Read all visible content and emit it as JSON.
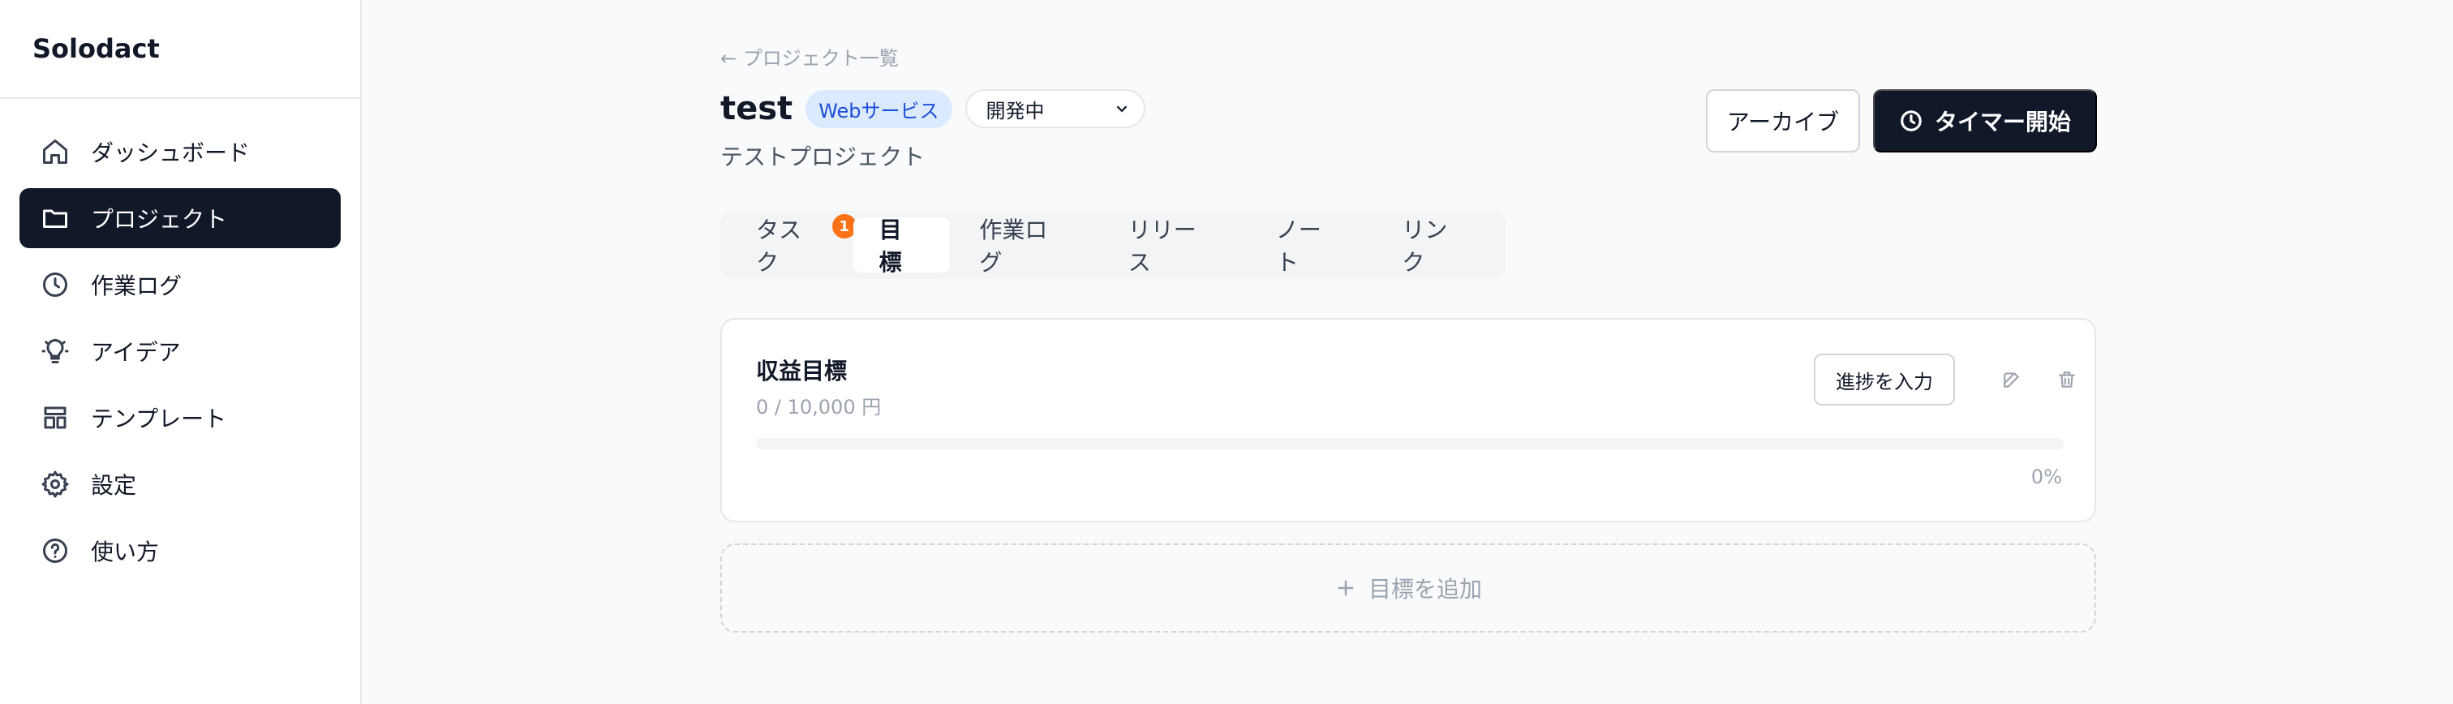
{
  "app": {
    "name": "Solodact"
  },
  "sidebar": {
    "items": [
      {
        "label": "ダッシュボード",
        "icon": "home-icon",
        "active": false
      },
      {
        "label": "プロジェクト",
        "icon": "folder-icon",
        "active": true
      },
      {
        "label": "作業ログ",
        "icon": "clock-icon",
        "active": false
      },
      {
        "label": "アイデア",
        "icon": "lightbulb-icon",
        "active": false
      },
      {
        "label": "テンプレート",
        "icon": "template-icon",
        "active": false
      },
      {
        "label": "設定",
        "icon": "gear-icon",
        "active": false
      },
      {
        "label": "使い方",
        "icon": "help-icon",
        "active": false
      }
    ]
  },
  "header": {
    "back_label": "← プロジェクト一覧",
    "title": "test",
    "category_badge": "Webサービス",
    "status_select": "開発中",
    "description": "テストプロジェクト",
    "archive_label": "アーカイブ",
    "timer_label": "タイマー開始"
  },
  "tabs": [
    {
      "label": "タスク",
      "badge": "1",
      "active": false
    },
    {
      "label": "目標",
      "active": true
    },
    {
      "label": "作業ログ",
      "active": false
    },
    {
      "label": "リリース",
      "active": false
    },
    {
      "label": "ノート",
      "active": false
    },
    {
      "label": "リンク",
      "active": false
    }
  ],
  "goals": [
    {
      "title": "収益目標",
      "amount": "0 / 10,000 円",
      "progress_button": "進捗を入力",
      "progress_percent": 0,
      "progress_label": "0%"
    }
  ],
  "add_goal_label": "目標を追加",
  "colors": {
    "primary": "#111827",
    "badge_bg": "#dbeafe",
    "badge_text": "#1d4ed8",
    "notification": "#f97316"
  }
}
